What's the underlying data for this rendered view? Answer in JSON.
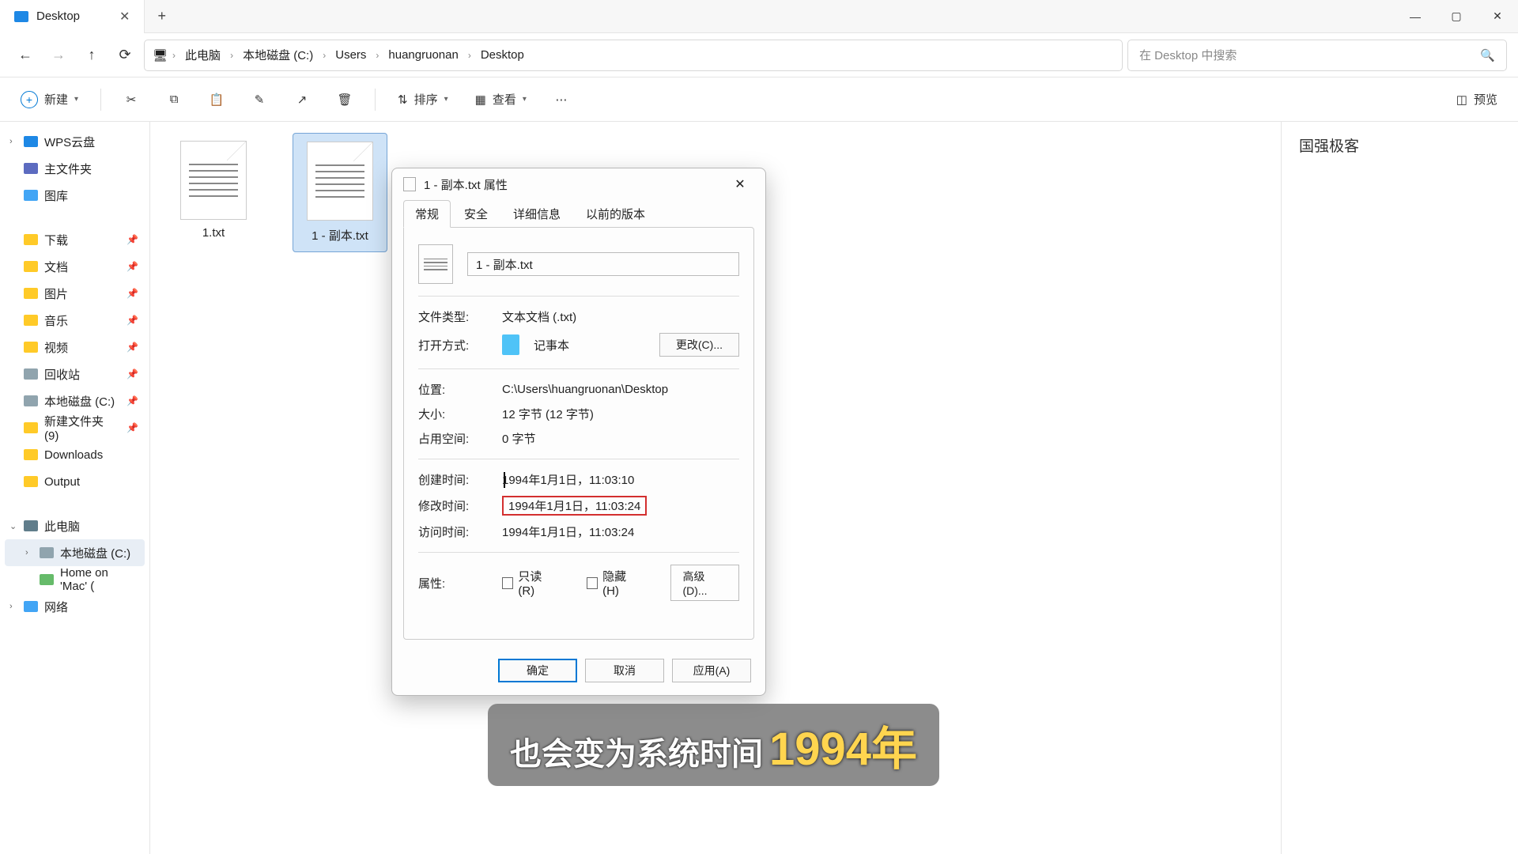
{
  "titlebar": {
    "tab_title": "Desktop"
  },
  "nav": {
    "breadcrumbs": [
      "此电脑",
      "本地磁盘 (C:)",
      "Users",
      "huangruonan",
      "Desktop"
    ],
    "search_placeholder": "在 Desktop 中搜索"
  },
  "toolbar": {
    "new": "新建",
    "sort": "排序",
    "view": "查看",
    "preview": "预览"
  },
  "sidebar": {
    "wps": "WPS云盘",
    "home": "主文件夹",
    "gallery": "图库",
    "downloads_cn": "下载",
    "documents": "文档",
    "pictures": "图片",
    "music": "音乐",
    "videos": "视频",
    "recycle": "回收站",
    "drive_c": "本地磁盘 (C:)",
    "newfolder": "新建文件夹 (9)",
    "downloads_en": "Downloads",
    "output": "Output",
    "thispc": "此电脑",
    "drive_c2": "本地磁盘 (C:)",
    "home_mac": "Home on 'Mac' (",
    "network": "网络"
  },
  "files": {
    "f1": "1.txt",
    "f2": "1 - 副本.txt"
  },
  "panel": {
    "watermark": "国强极客"
  },
  "dlg": {
    "title": "1 - 副本.txt 属性",
    "tabs": {
      "general": "常规",
      "security": "安全",
      "details": "详细信息",
      "prev": "以前的版本"
    },
    "filename": "1 - 副本.txt",
    "type_label": "文件类型:",
    "type_value": "文本文档 (.txt)",
    "open_label": "打开方式:",
    "open_value": "记事本",
    "change_btn": "更改(C)...",
    "loc_label": "位置:",
    "loc_value": "C:\\Users\\huangruonan\\Desktop",
    "size_label": "大小:",
    "size_value": "12 字节 (12 字节)",
    "disk_label": "占用空间:",
    "disk_value": "0 字节",
    "created_label": "创建时间:",
    "created_value": "1994年1月1日，11:03:10",
    "modified_label": "修改时间:",
    "modified_value": "1994年1月1日，11:03:24",
    "accessed_label": "访问时间:",
    "accessed_value": "1994年1月1日，11:03:24",
    "attr_label": "属性:",
    "readonly": "只读(R)",
    "hidden": "隐藏(H)",
    "advanced": "高级(D)...",
    "ok": "确定",
    "cancel": "取消",
    "apply": "应用(A)"
  },
  "caption": {
    "text": "也会变为系统时间",
    "year": "1994年"
  }
}
